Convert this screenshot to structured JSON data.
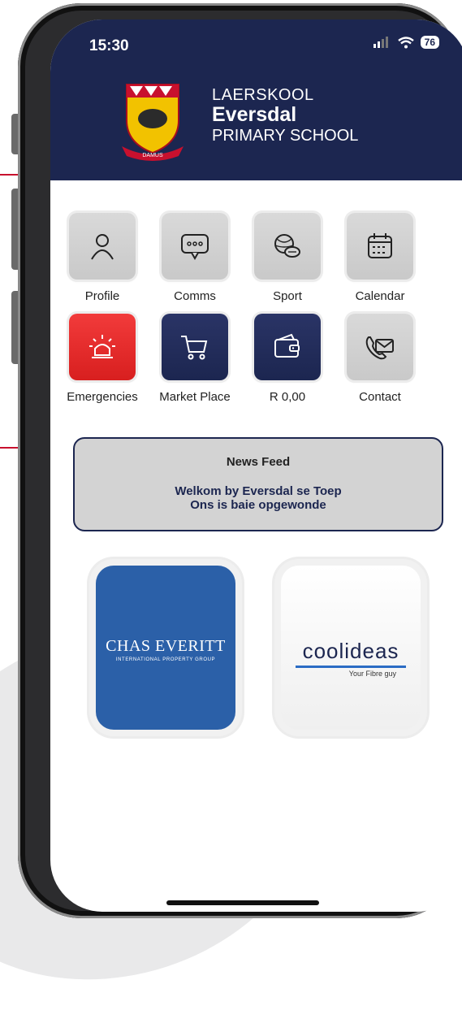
{
  "status_bar": {
    "time": "15:30",
    "battery": "76"
  },
  "school": {
    "line1": "LAERSKOOL",
    "line2": "Eversdal",
    "line3": "PRIMARY SCHOOL",
    "motto": "DAMUS"
  },
  "tiles": [
    {
      "label": "Profile",
      "icon": "person-icon"
    },
    {
      "label": "Comms",
      "icon": "chat-bubble-icon"
    },
    {
      "label": "Sport",
      "icon": "sports-balls-icon"
    },
    {
      "label": "Calendar",
      "icon": "calendar-icon"
    },
    {
      "label": "Emergencies",
      "icon": "siren-icon"
    },
    {
      "label": "Market Place",
      "icon": "cart-icon"
    },
    {
      "label": "R 0,00",
      "icon": "wallet-icon"
    },
    {
      "label": "Contact",
      "icon": "phone-envelope-icon"
    }
  ],
  "news": {
    "title": "News Feed",
    "line1": "Welkom by Eversdal se Toep",
    "line2": "Ons is baie opgewonde"
  },
  "sponsors": {
    "chas": {
      "name": "CHAS EVERITT",
      "tagline": "INTERNATIONAL PROPERTY GROUP"
    },
    "cool": {
      "name": "coolideas",
      "tagline": "Your Fibre guy"
    }
  },
  "colors": {
    "header": "#1c2650",
    "emergency": "#e02a2a",
    "chas": "#2b60a8"
  }
}
